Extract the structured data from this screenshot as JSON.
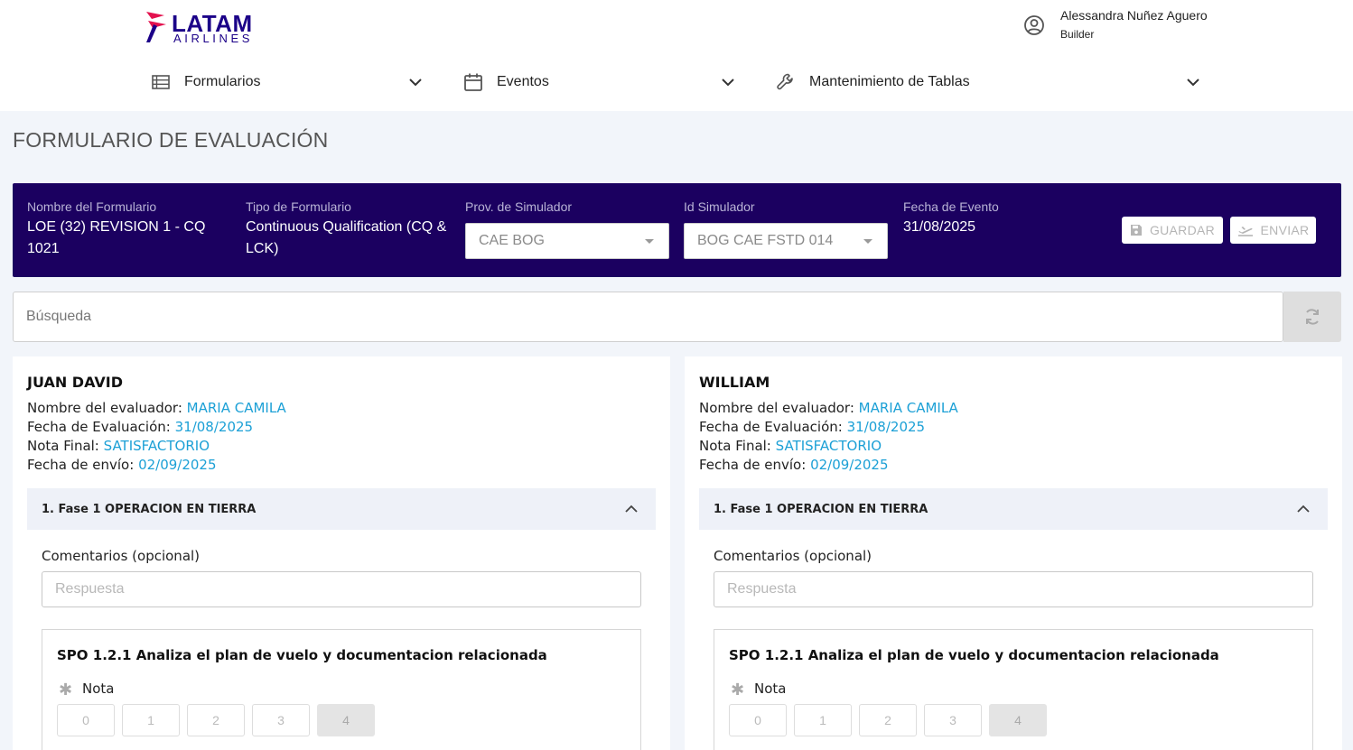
{
  "header": {
    "logo": {
      "name": "LATAM",
      "sub": "AIRLINES"
    },
    "user": {
      "name": "Alessandra Nuñez Aguero",
      "role": "Builder"
    },
    "nav": [
      {
        "label": "Formularios",
        "icon": "list-icon"
      },
      {
        "label": "Eventos",
        "icon": "calendar-icon"
      },
      {
        "label": "Mantenimiento de Tablas",
        "icon": "wrench-icon"
      }
    ]
  },
  "page_title": "FORMULARIO DE EVALUACIÓN",
  "banner": {
    "form_name_label": "Nombre del Formulario",
    "form_name_value": "LOE (32) REVISION 1 - CQ 1021",
    "form_type_label": "Tipo de Formulario",
    "form_type_value": "Continuous Qualification (CQ & LCK)",
    "sim_provider_label": "Prov. de Simulador",
    "sim_provider_value": "CAE BOG",
    "sim_id_label": "Id Simulador",
    "sim_id_value": "BOG CAE FSTD 014",
    "event_date_label": "Fecha de Evento",
    "event_date_value": "31/08/2025",
    "save_label": "GUARDAR",
    "send_label": "ENVIAR"
  },
  "search": {
    "placeholder": "Búsqueda",
    "value": ""
  },
  "cards": [
    {
      "name": "JUAN DAVID",
      "evaluator_label": "Nombre del evaluador:",
      "evaluator": "MARIA CAMILA",
      "eval_date_label": "Fecha de Evaluación:",
      "eval_date": "31/08/2025",
      "final_grade_label": "Nota Final:",
      "final_grade": "SATISFACTORIO",
      "send_date_label": "Fecha de envío:",
      "send_date": "02/09/2025",
      "phase_title": "1. Fase 1 OPERACION EN TIERRA",
      "comments_label": "Comentarios (opcional)",
      "answer_placeholder": "Respuesta",
      "question": "SPO 1.2.1 Analiza el plan de vuelo y documentacion relacionada",
      "nota_label": "Nota",
      "scores": [
        "0",
        "1",
        "2",
        "3",
        "4"
      ],
      "selected_score": "4"
    },
    {
      "name": "WILLIAM",
      "evaluator_label": "Nombre del evaluador:",
      "evaluator": "MARIA CAMILA",
      "eval_date_label": "Fecha de Evaluación:",
      "eval_date": "31/08/2025",
      "final_grade_label": "Nota Final:",
      "final_grade": "SATISFACTORIO",
      "send_date_label": "Fecha de envío:",
      "send_date": "02/09/2025",
      "phase_title": "1. Fase 1 OPERACION EN TIERRA",
      "comments_label": "Comentarios (opcional)",
      "answer_placeholder": "Respuesta",
      "question": "SPO 1.2.1 Analiza el plan de vuelo y documentacion relacionada",
      "nota_label": "Nota",
      "scores": [
        "0",
        "1",
        "2",
        "3",
        "4"
      ],
      "selected_score": "4"
    }
  ],
  "colors": {
    "brand": "#1b0088",
    "banner_bg": "#1b0060",
    "highlight": "#1ca0d6"
  }
}
